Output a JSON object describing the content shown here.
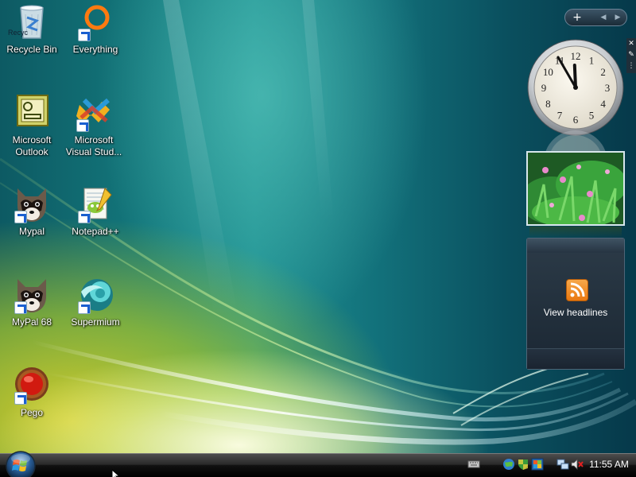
{
  "desktop": {
    "icons": [
      {
        "label": "Recycle Bin",
        "overlay_text": "Recyc"
      },
      {
        "label": "Everything"
      },
      {
        "label": "Microsoft Outlook"
      },
      {
        "label": "Microsoft Visual Stud..."
      },
      {
        "label": "Mypal"
      },
      {
        "label": "Notepad++"
      },
      {
        "label": "MyPal 68"
      },
      {
        "label": "Supermium"
      },
      {
        "label": "Pego"
      }
    ]
  },
  "sidebar": {
    "add_label": "+",
    "prev_label": "◀",
    "next_label": "▶",
    "clock": {
      "hour": 11,
      "minute": 55
    },
    "feed": {
      "label": "View headlines"
    }
  },
  "taskbar": {
    "clock_text": "11:55 AM"
  },
  "colors": {
    "rss_orange": "#f0881e",
    "taskbar_black": "#111111"
  }
}
